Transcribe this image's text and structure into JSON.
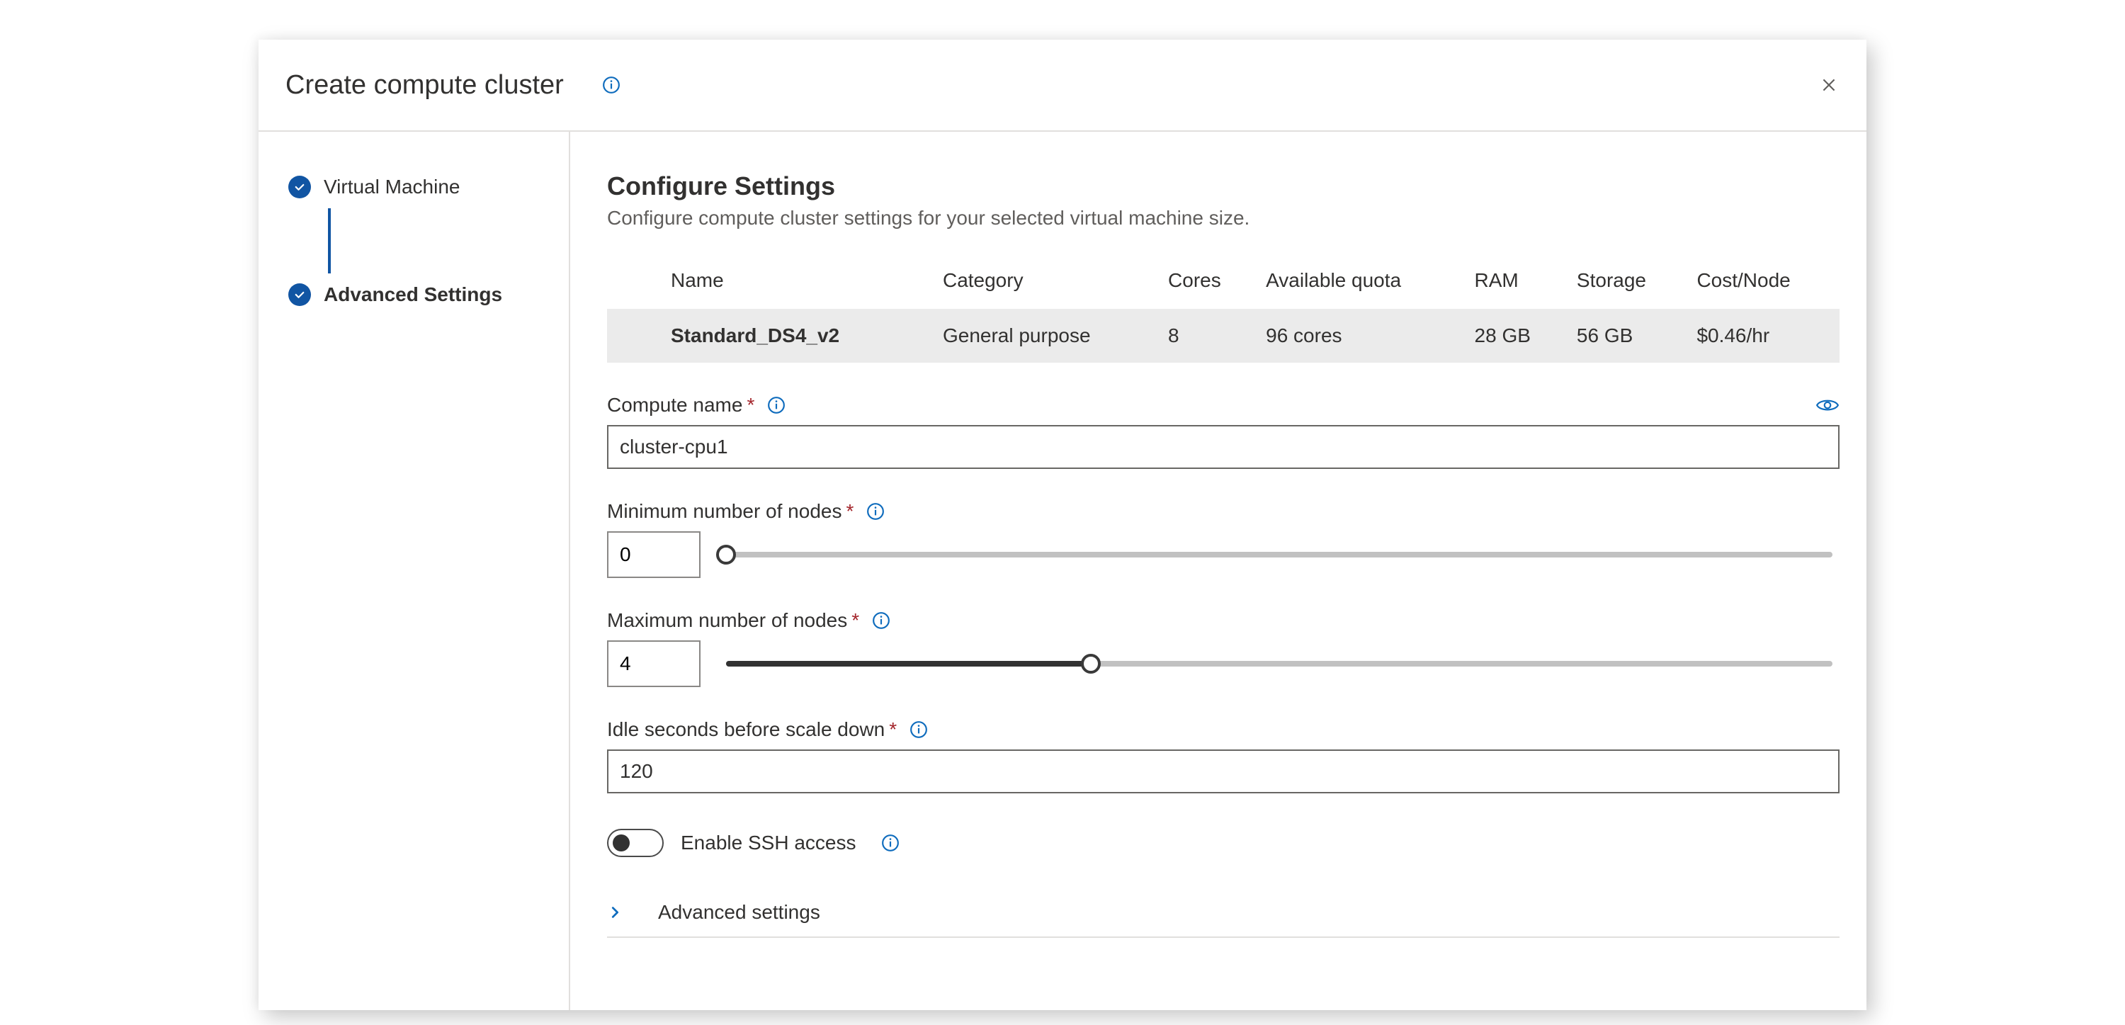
{
  "dialog": {
    "title": "Create compute cluster"
  },
  "nav": {
    "steps": [
      {
        "label": "Virtual Machine",
        "active": false
      },
      {
        "label": "Advanced Settings",
        "active": true
      }
    ]
  },
  "section": {
    "title": "Configure Settings",
    "subtitle": "Configure compute cluster settings for your selected virtual machine size."
  },
  "summary": {
    "headers": {
      "name": "Name",
      "category": "Category",
      "cores": "Cores",
      "quota": "Available quota",
      "ram": "RAM",
      "storage": "Storage",
      "cost": "Cost/Node"
    },
    "row": {
      "name": "Standard_DS4_v2",
      "category": "General purpose",
      "cores": "8",
      "quota": "96 cores",
      "ram": "28 GB",
      "storage": "56 GB",
      "cost": "$0.46/hr"
    }
  },
  "form": {
    "compute_name": {
      "label": "Compute name",
      "value": "cluster-cpu1"
    },
    "min_nodes": {
      "label": "Minimum number of nodes",
      "value": "0",
      "percent": 0
    },
    "max_nodes": {
      "label": "Maximum number of nodes",
      "value": "4",
      "percent": 33
    },
    "idle_seconds": {
      "label": "Idle seconds before scale down",
      "value": "120"
    },
    "ssh": {
      "label": "Enable SSH access",
      "on": false
    },
    "advanced": {
      "label": "Advanced settings"
    }
  }
}
